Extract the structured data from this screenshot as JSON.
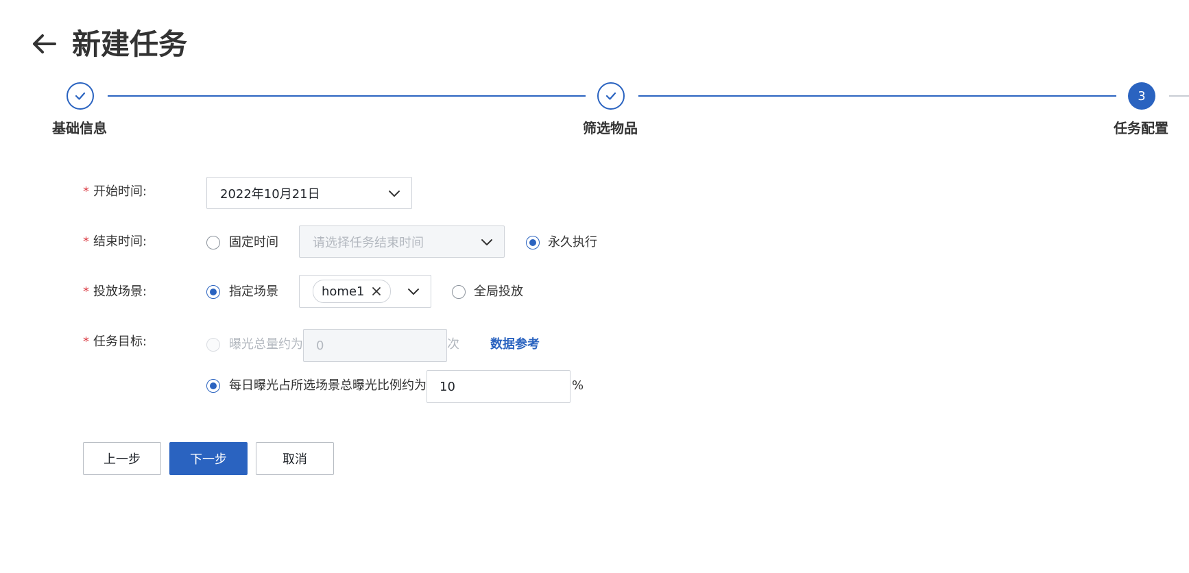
{
  "header": {
    "title": "新建任务",
    "back_icon": "arrow-left-icon"
  },
  "steps": [
    {
      "label": "基础信息",
      "status": "done"
    },
    {
      "label": "筛选物品",
      "status": "done"
    },
    {
      "label": "任务配置",
      "status": "active",
      "number": "3"
    }
  ],
  "form": {
    "required_mark": "*",
    "start_time": {
      "label": "开始时间:",
      "value": "2022年10月21日"
    },
    "end_time": {
      "label": "结束时间:",
      "fixed_option": "固定时间",
      "placeholder": "请选择任务结束时间",
      "forever_option": "永久执行",
      "selected": "forever"
    },
    "scene": {
      "label": "投放场景:",
      "specific_option": "指定场景",
      "tags": [
        "home1"
      ],
      "global_option": "全局投放",
      "selected": "specific"
    },
    "goal": {
      "label": "任务目标:",
      "total_option": "曝光总量约为",
      "total_value": "0",
      "total_unit": "次",
      "data_link": "数据参考",
      "ratio_option": "每日曝光占所选场景总曝光比例约为",
      "ratio_value": "10",
      "ratio_unit": "%",
      "selected": "ratio"
    }
  },
  "buttons": {
    "prev": "上一步",
    "next": "下一步",
    "cancel": "取消"
  },
  "colors": {
    "primary": "#2a63c0",
    "required": "#d9363e",
    "line_pending": "#c9cdd4"
  }
}
